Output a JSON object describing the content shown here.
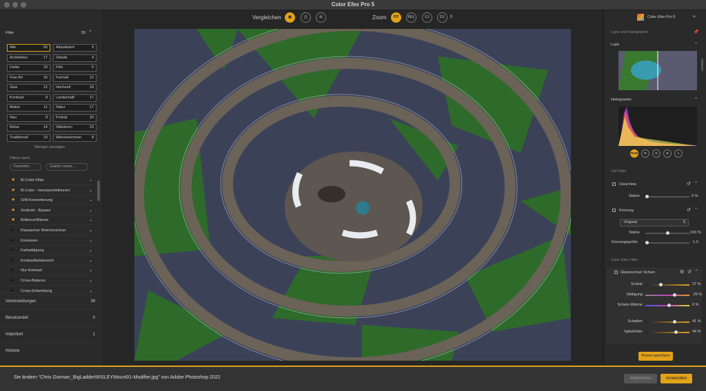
{
  "window": {
    "title": "Color Efex Pro 5"
  },
  "left": {
    "filter_label": "Filter",
    "filter_count": "55",
    "categories": [
      {
        "label": "Alle",
        "count": "55",
        "selected": true
      },
      {
        "label": "Aktualisiert",
        "count": "9"
      },
      {
        "label": "Architektur",
        "count": "17"
      },
      {
        "label": "Details",
        "count": "4"
      },
      {
        "label": "Farbe",
        "count": "19"
      },
      {
        "label": "Film",
        "count": "6"
      },
      {
        "label": "Fine Art",
        "count": "16"
      },
      {
        "label": "Formell",
        "count": "12"
      },
      {
        "label": "Glas",
        "count": "12"
      },
      {
        "label": "Hochzeit",
        "count": "18"
      },
      {
        "label": "Kontrast",
        "count": "8"
      },
      {
        "label": "Landschaft",
        "count": "17"
      },
      {
        "label": "Makro",
        "count": "11"
      },
      {
        "label": "Natur",
        "count": "17"
      },
      {
        "label": "Neu",
        "count": "8"
      },
      {
        "label": "Porträt",
        "count": "20"
      },
      {
        "label": "Reise",
        "count": "14"
      },
      {
        "label": "Stilisieren",
        "count": "23"
      },
      {
        "label": "Traditionell",
        "count": "19"
      },
      {
        "label": "Weichzeichnen",
        "count": "8"
      }
    ],
    "show_less": "Weniger anzeigen",
    "filter_by": "Filtern nach:",
    "chip_favorites": "Favoriten",
    "chip_recent": "Zuletzt verwe...",
    "filters": [
      {
        "label": "Bi-Color-Filter",
        "fav": true
      },
      {
        "label": "Bi-Color – benutzerdefinieren",
        "fav": true
      },
      {
        "label": "S/W-Konvertierung",
        "fav": true
      },
      {
        "label": "Gedeckt - Bypass",
        "fav": true
      },
      {
        "label": "Brillance/Wärme",
        "fav": true
      },
      {
        "label": "Klassischer Weichzeichner",
        "fav": false
      },
      {
        "label": "Konvieren",
        "fav": false
      },
      {
        "label": "Farbsättigung",
        "fav": false
      },
      {
        "label": "Kontrastfarbbereich",
        "fav": false
      },
      {
        "label": "Nur Kontrast",
        "fav": false
      },
      {
        "label": "Cross-Balance",
        "fav": false
      },
      {
        "label": "Cross-Entwicklung",
        "fav": false
      }
    ],
    "sections": [
      {
        "label": "Voreinstellungen",
        "value": "39"
      },
      {
        "label": "Benutzerdef.",
        "value": "0"
      },
      {
        "label": "Importiert",
        "value": "1"
      },
      {
        "label": "Historie",
        "value": ""
      }
    ]
  },
  "toolbar": {
    "compare": "Vergleichen",
    "zoom": "Zoom",
    "zoom_fit": "FIT",
    "zoom_fill": "FILL",
    "zoom_11": "1:1",
    "zoom_21": "2:1"
  },
  "right": {
    "app_name": "Color Efex Pro 5",
    "loupe_section": "Lupe und Histogramm",
    "loupe": "Lupe",
    "histogram": "Histogramm",
    "channels": [
      "RGB",
      "R",
      "G",
      "B",
      "L"
    ],
    "cef_filters": "Cef Filter",
    "clearview": "ClearView",
    "staerke": "Stärke",
    "clearview_val": "0 %",
    "koernung": "Körnung",
    "koernung_preset": "Original",
    "koernung_staerke": "100 %",
    "koernungsgroesse": "Körnungsgröße",
    "koernungsgroesse_val": "1.0",
    "cef_filter2": "Color Efex Filter",
    "glam": "Glamouröser Schein",
    "sliders": [
      {
        "label": "Schein",
        "value": "27 %"
      },
      {
        "label": "Sättigung",
        "value": "-29 %"
      },
      {
        "label": "Schein-Wärme",
        "value": "0 %"
      },
      {
        "label": "Schatten",
        "value": "41 %"
      },
      {
        "label": "Spitzlichter",
        "value": "44 %"
      }
    ],
    "preset_save": "Preset speichern"
  },
  "bottom": {
    "message": "Sie ändern “Chris Gorman_BigLadderWISLEYMount01-Modifier.jpg” von Adobe Photoshop 2022",
    "cancel": "Abbrechen",
    "apply": "Anwenden"
  },
  "colors": {
    "accent": "#e2a21a"
  }
}
